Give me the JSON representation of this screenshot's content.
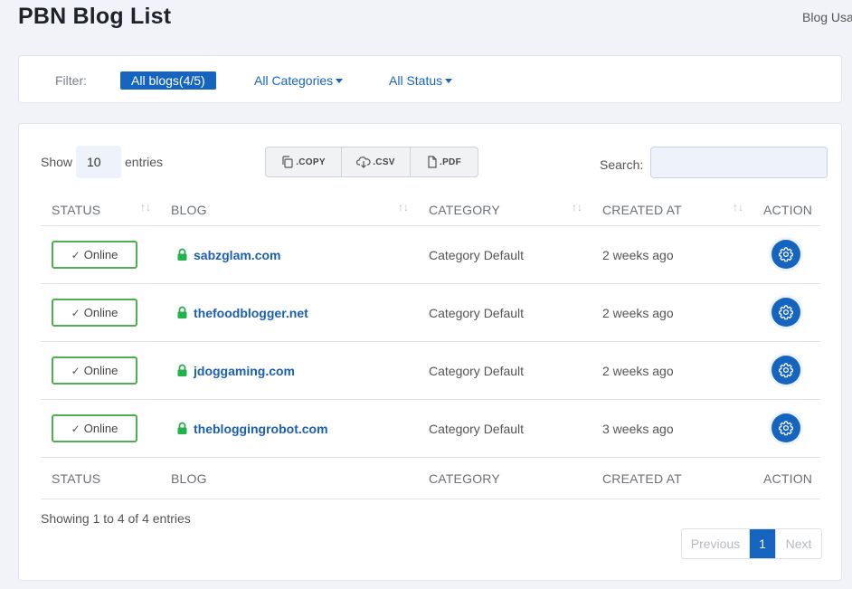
{
  "header": {
    "title": "PBN Blog List",
    "breadcrumb": "Blog Usa"
  },
  "filter": {
    "label": "Filter:",
    "all_blogs": "All blogs(4/5)",
    "categories": "All Categories",
    "status": "All Status"
  },
  "table_controls": {
    "show_label": "Show",
    "entries_value": "10",
    "entries_label": "entries",
    "copy": ".COPY",
    "csv": ".CSV",
    "pdf": ".PDF",
    "search_label": "Search:",
    "search_value": ""
  },
  "columns": [
    "STATUS",
    "BLOG",
    "CATEGORY",
    "CREATED AT",
    "ACTION"
  ],
  "rows": [
    {
      "status": "Online",
      "blog": "sabzglam.com",
      "category": "Category Default",
      "created": "2 weeks ago"
    },
    {
      "status": "Online",
      "blog": "thefoodblogger.net",
      "category": "Category Default",
      "created": "2 weeks ago"
    },
    {
      "status": "Online",
      "blog": "jdoggaming.com",
      "category": "Category Default",
      "created": "2 weeks ago"
    },
    {
      "status": "Online",
      "blog": "thebloggingrobot.com",
      "category": "Category Default",
      "created": "3 weeks ago"
    }
  ],
  "footer": {
    "info": "Showing 1 to 4 of 4 entries",
    "prev": "Previous",
    "page": "1",
    "next": "Next"
  },
  "colors": {
    "primary": "#1565c0",
    "online_border": "#4caf50",
    "lock": "#22b14c"
  },
  "icons": {
    "status_check": "check-icon",
    "blog_lock": "lock-icon",
    "action": "gear-icon",
    "sort": "sort-icon",
    "copy": "copy-icon",
    "csv": "download-icon",
    "pdf": "file-icon"
  }
}
